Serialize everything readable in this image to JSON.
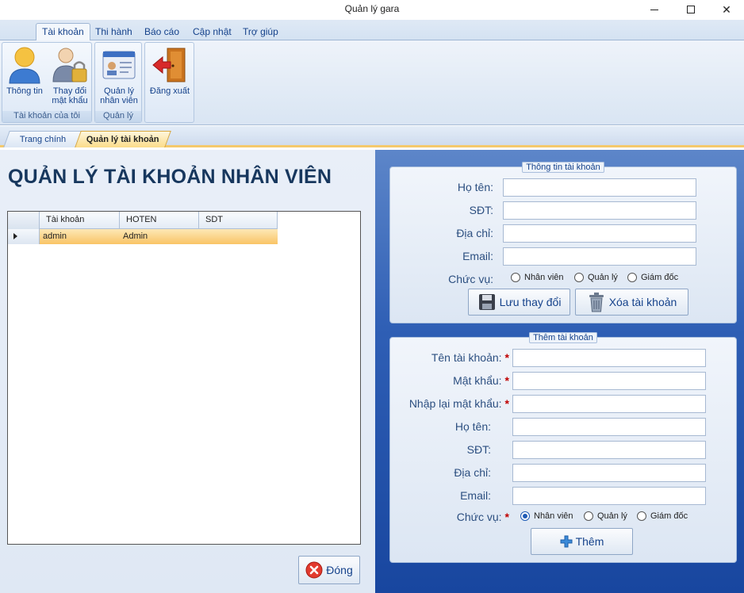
{
  "window": {
    "title": "Quản lý gara"
  },
  "ribbon": {
    "tabs": [
      "Tài khoản",
      "Thi hành",
      "Báo cáo",
      "Cập nhật",
      "Trợ giúp"
    ],
    "groups": [
      {
        "label": "Tài khoản của tôi",
        "buttons": [
          "Thông tin",
          "Thay đổi mật khẩu"
        ]
      },
      {
        "label": "Quản lý",
        "buttons": [
          "Quản lý nhân viên"
        ]
      },
      {
        "label": "",
        "buttons": [
          "Đăng xuất"
        ]
      }
    ]
  },
  "doc_tabs": [
    "Trang chính",
    "Quản lý tài khoản"
  ],
  "left": {
    "title": "QUẢN LÝ TÀI KHOẢN NHÂN VIÊN",
    "grid": {
      "columns": [
        "Tài khoản",
        "HOTEN",
        "SDT"
      ],
      "rows": [
        {
          "tai_khoan": "admin",
          "hoten": "Admin",
          "sdt": ""
        }
      ]
    },
    "close_button": "Đóng"
  },
  "info_box": {
    "title": "Thông tin tài khoản",
    "labels": {
      "hoten": "Họ tên:",
      "sdt": "SĐT:",
      "diachi": "Địa chỉ:",
      "email": "Email:",
      "chucvu": "Chức vụ:"
    },
    "values": {
      "hoten": "",
      "sdt": "",
      "diachi": "",
      "email": ""
    },
    "roles": [
      "Nhân viên",
      "Quản lý",
      "Giám đốc"
    ],
    "save_button": "Lưu thay đổi",
    "delete_button": "Xóa tài khoản"
  },
  "add_box": {
    "title": "Thêm tài khoản",
    "labels": {
      "tentk": "Tên tài khoản:",
      "matkhau": "Mật khẩu:",
      "nhaplai": "Nhập lại mật khẩu:",
      "hoten": "Họ tên:",
      "sdt": "SĐT:",
      "diachi": "Địa chỉ:",
      "email": "Email:",
      "chucvu": "Chức vụ:"
    },
    "required_mark": "*",
    "roles": [
      "Nhân viên",
      "Quản lý",
      "Giám đốc"
    ],
    "selected_role": "Nhân viên",
    "add_button": "Thêm"
  },
  "colors": {
    "ribbon_text": "#15428b",
    "selected_row": "#f9c466",
    "accent_panel": "#2f5fb5",
    "required": "#c00000"
  }
}
